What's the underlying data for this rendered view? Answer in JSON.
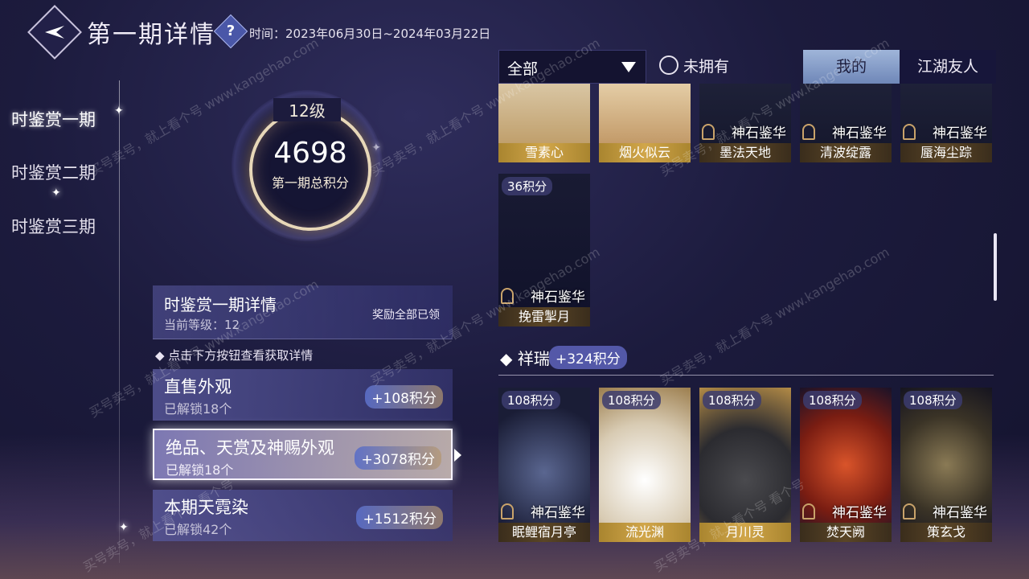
{
  "header": {
    "title": "第一期详情",
    "help": "?",
    "date_range": "时间：2023年06月30日~2024年03月22日"
  },
  "nav": [
    "时鉴赏一期",
    "时鉴赏二期",
    "时鉴赏三期"
  ],
  "summary": {
    "level": "12级",
    "score": "4698",
    "score_label": "第一期总积分"
  },
  "detail": {
    "title": "时鉴赏一期详情",
    "current_level": "当前等级：12",
    "reward_status": "奖励全部已领",
    "hint": "◆ 点击下方按钮查看获取详情"
  },
  "categories": [
    {
      "name": "直售外观",
      "sub": "已解锁18个",
      "points": "+108积分",
      "selected": false
    },
    {
      "name": "绝品、天赏及神赐外观",
      "sub": "已解锁18个",
      "points": "+3078积分",
      "selected": true
    },
    {
      "name": "本期天霓染",
      "sub": "已解锁42个",
      "points": "+1512积分",
      "selected": false
    }
  ],
  "filters": {
    "dropdown": "全部",
    "unowned": "未拥有",
    "tab_mine": "我的",
    "tab_friends": "江湖友人"
  },
  "items_top": [
    {
      "name": "雪素心",
      "style": "gold",
      "badge": ""
    },
    {
      "name": "烟火似云",
      "style": "gold",
      "badge": ""
    },
    {
      "name": "墨法天地",
      "style": "dark",
      "badge": "神石鉴华"
    },
    {
      "name": "清波绽露",
      "style": "dark",
      "badge": "神石鉴华"
    },
    {
      "name": "蜃海尘踪",
      "style": "dark",
      "badge": "神石鉴华"
    },
    {
      "name": "挽雷掣月",
      "style": "dark",
      "badge": "神石鉴华",
      "points": "36积分"
    }
  ],
  "section": {
    "title": "◆ 祥瑞",
    "points": "+324积分"
  },
  "items_bottom": [
    {
      "name": "眠鲤宿月亭",
      "style": "dark",
      "badge": "神石鉴华",
      "points": "108积分"
    },
    {
      "name": "流光渊",
      "style": "gold",
      "badge": "",
      "points": "108积分"
    },
    {
      "name": "月川灵",
      "style": "gold",
      "badge": "",
      "points": "108积分"
    },
    {
      "name": "焚天阙",
      "style": "dark",
      "badge": "神石鉴华",
      "points": "108积分"
    },
    {
      "name": "策玄戈",
      "style": "dark",
      "badge": "神石鉴华",
      "points": "108积分"
    }
  ],
  "watermark": {
    "line1": "买号卖号，就上看个号",
    "line2": "www.kangehao.com",
    "brand": "看个号"
  }
}
